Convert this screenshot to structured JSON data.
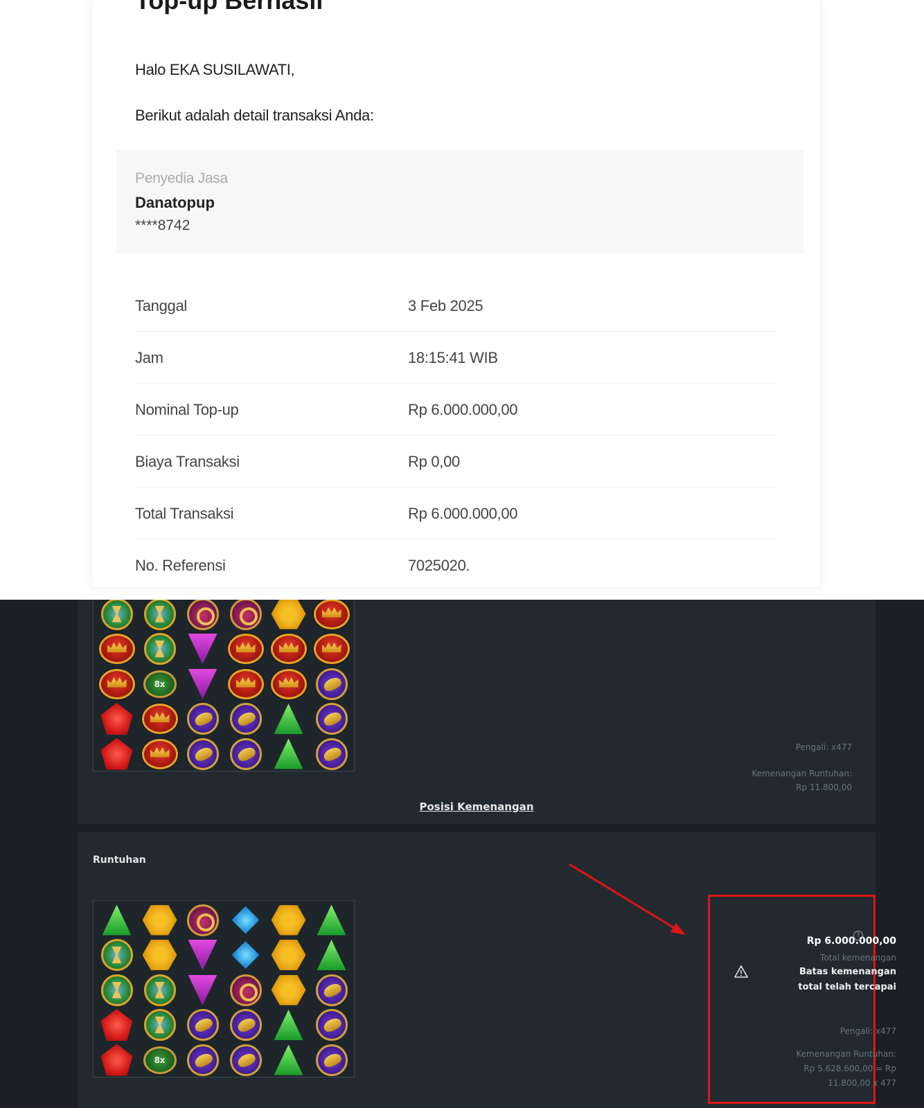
{
  "email": {
    "title": "Top-up Berhasil",
    "greeting": "Halo EKA SUSILAWATI,",
    "intro": "Berikut adalah detail transaksi Anda:",
    "provider": {
      "label": "Penyedia Jasa",
      "name": "Danatopup",
      "account": "****8742"
    },
    "details": [
      {
        "label": "Tanggal",
        "value": "3 Feb 2025"
      },
      {
        "label": "Jam",
        "value": "18:15:41 WIB"
      },
      {
        "label": "Nominal Top-up",
        "value": "Rp 6.000.000,00"
      },
      {
        "label": "Biaya Transaksi",
        "value": "Rp 0,00"
      },
      {
        "label": "Total Transaksi",
        "value": "Rp 6.000.000,00"
      },
      {
        "label": "No. Referensi",
        "value": "7025020."
      }
    ]
  },
  "game": {
    "grid_1": [
      [
        "hourglass",
        "hourglass",
        "ring",
        "ring",
        "hex",
        "crown"
      ],
      [
        "crown",
        "hourglass",
        "tri-purple",
        "crown",
        "crown",
        "crown"
      ],
      [
        "crown",
        "mult",
        "tri-purple",
        "crown",
        "crown",
        "scarab"
      ],
      [
        "penta",
        "crown",
        "scarab",
        "scarab",
        "tri-green",
        "scarab"
      ],
      [
        "penta",
        "crown",
        "scarab",
        "scarab",
        "tri-green",
        "scarab"
      ]
    ],
    "grid_2": [
      [
        "tri-green",
        "hex",
        "ring",
        "diamond",
        "hex",
        "tri-green"
      ],
      [
        "hourglass",
        "hex",
        "tri-purple",
        "diamond",
        "hex",
        "tri-green"
      ],
      [
        "hourglass",
        "hourglass",
        "tri-purple",
        "ring",
        "hex",
        "scarab"
      ],
      [
        "penta",
        "hourglass",
        "scarab",
        "scarab",
        "tri-green",
        "scarab"
      ],
      [
        "penta",
        "mult",
        "scarab",
        "scarab",
        "tri-green",
        "scarab"
      ]
    ],
    "multiplier_symbol_text": "8x",
    "panel_1": {
      "multiplier": "Pengali: x477",
      "cascade_win_label": "Kemenangan Runtuhan:",
      "cascade_win_value": "Rp 11.800,00",
      "win_position_link": "Posisi Kemenangan"
    },
    "panel_2": {
      "title": "Runtuhan",
      "total_win_value": "Rp 6.000.000,00",
      "total_win_label": "Total kemenangan",
      "limit_line1": "Batas kemenangan",
      "limit_line2": "total telah tercapai",
      "multiplier": "Pengali: x477",
      "cascade_win_label": "Kemenangan Runtuhan:",
      "cascade_win_line1": "Rp 5.628.600,00 = Rp",
      "cascade_win_line2": "11.800,00 x 477"
    },
    "icons": {
      "info": "info-icon",
      "warning": "warning-triangle-icon",
      "annotation_arrow": "red-arrow"
    },
    "colors": {
      "highlight_box": "#e01515",
      "panel_bg": "#222a30",
      "page_bg": "#1c2024"
    }
  }
}
